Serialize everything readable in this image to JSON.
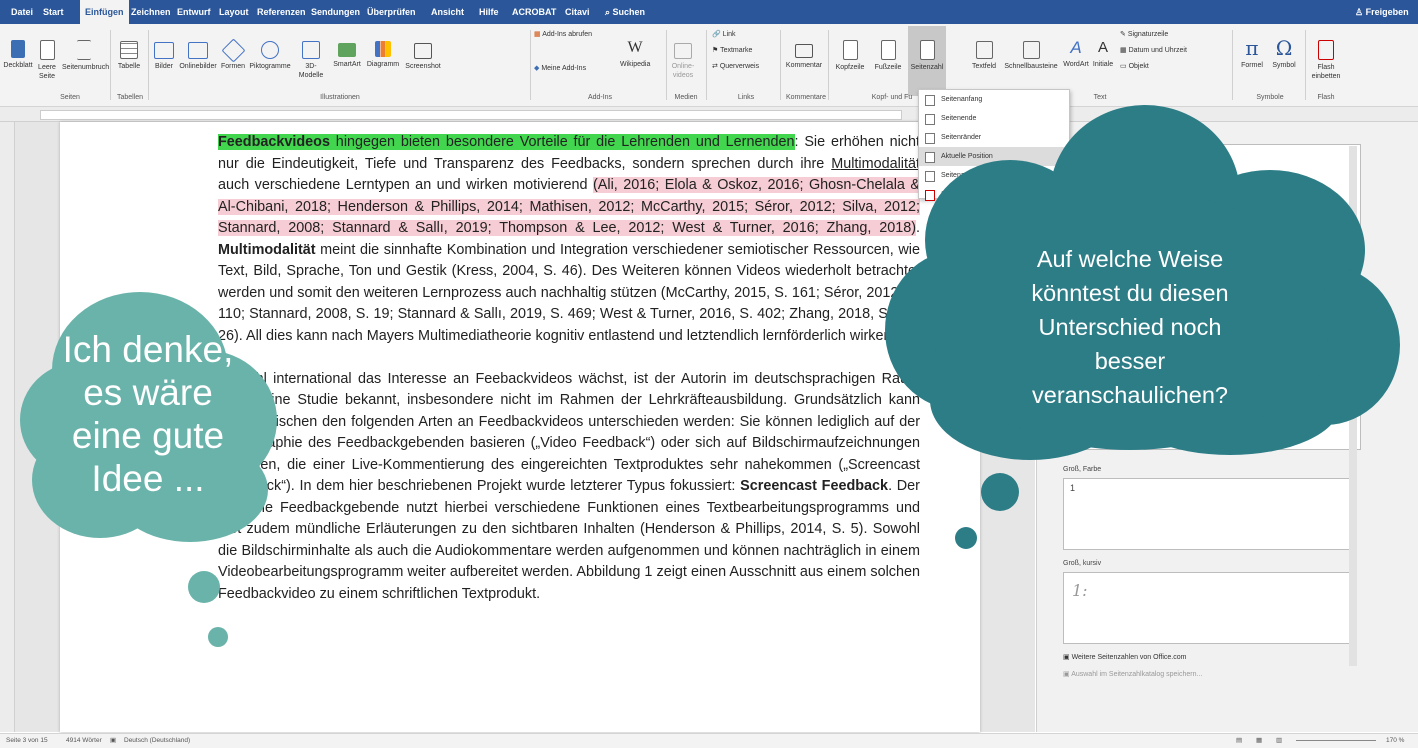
{
  "ribbon_tabs": [
    "Datei",
    "Start",
    "Einfügen",
    "Zeichnen",
    "Entwurf",
    "Layout",
    "Referenzen",
    "Sendungen",
    "Überprüfen",
    "Ansicht",
    "Hilfe",
    "ACROBAT",
    "Citavi"
  ],
  "active_tab": "Einfügen",
  "search_label": "Suchen",
  "share_label": "Freigeben",
  "ribbon_buttons": [
    "Deckblatt",
    "Leere Seite",
    "Seitenumbruch",
    "Tabelle",
    "Bilder",
    "Onlinebilder",
    "Formen",
    "Piktogramme",
    "3D-Modelle",
    "SmartArt",
    "Diagramm",
    "Screenshot",
    "Add-Ins abrufen",
    "Meine Add-Ins",
    "Wikipedia",
    "Online-videos",
    "Link",
    "Textmarke",
    "Querverweis",
    "Kommentar",
    "Kopfzeile",
    "Fußzeile",
    "Seitenzahl",
    "Textfeld",
    "Schnellbausteine",
    "WordArt",
    "Initiale",
    "Signaturzeile",
    "Datum und Uhrzeit",
    "Objekt",
    "Formel",
    "Symbol",
    "Flash einbetten"
  ],
  "ribbon_groups": [
    "Seiten",
    "Tabellen",
    "Illustrationen",
    "Add-Ins",
    "Medien",
    "Links",
    "Kommentare",
    "Kopf- und Fu",
    "Text",
    "Symbole",
    "Flash"
  ],
  "dropdown_items": [
    "Seitenanfang",
    "Seitenende",
    "Seitenränder",
    "Aktuelle Position",
    "Seitenzahlen formatieren...",
    "Seitenzahlen entfernen"
  ],
  "panel": {
    "label1": "Groß, Farbe",
    "value1": "1",
    "label2": "Groß, kursiv",
    "value2": "1:",
    "link1": "Weitere Seitenzahlen von Office.com",
    "link2": "Auswahl im Seitenzahlkatalog speichern..."
  },
  "document": {
    "p1_green": "Feedbackvideos",
    "p1_green_rest": " hingegen bieten besondere Vorteile für die Lehrenden und Lernenden",
    "p1_a": ": Sie erhöhen nicht nur die Eindeutigkeit, Tiefe und Transparenz des Feedbacks, sondern sprechen durch ihre ",
    "p1_multi": "Multimodalität",
    "p1_b": " auch verschiedene Lerntypen an und wirken motivierend ",
    "p1_pink": "(Ali, 2016; Elola & Oskoz, 2016; Ghosn-Chelala & Al-Chibani, 2018; Henderson & Phillips, 2014; Mathisen, 2012; McCarthy, 2015; Séror, 2012; Silva, 2012; Stannard, 2008; Stannard & Sallı, 2019; Thompson & Lee, 2012; West & Turner, 2016; Zhang, 2018)",
    "p1_c": ". ",
    "p1_bold": "Multimodalität",
    "p1_d": " meint die sinnhafte Kombination und Integration verschiedener semiotischer Ressourcen, wie Text, Bild, Sprache, Ton und Gestik (Kress, 2004, S. 46). Des Weiteren können Videos wiederholt betrachtet werden und somit den weiteren Lernprozess auch nachhaltig stützen (McCarthy, 2015, S. 161; Séror, 2012, S. 110; Stannard, 2008, S. 19; Stannard & Sallı, 2019, S. 469; West & Turner, 2016, S. 402; Zhang, 2018, S. 25–26). All dies kann nach Mayers Multimediatheorie kognitiv entlastend und letztendlich lernförderlich wirken.",
    "p2_a": "Obwohl international das Interesse an Feebackvideos wächst, ist der Autorin im deutschsprachigen Raum noch keine Studie bekannt, insbesondere nicht im Rahmen der Lehrkräfteausbildung. Grundsätzlich kann dabei zwischen den folgenden Arten an Feedbackvideos unterschieden werden: Sie können lediglich auf der Videographie des Feedbackgebenden basieren („Video Feedback“) oder sich auf Bildschirmaufzeichnungen beziehen, die einer Live-Kommentierung des eingereichten Textproduktes sehr nahekommen („Screencast Feedback“). In dem hier beschriebenen Projekt wurde letzterer Typus fokussiert: ",
    "p2_bold": "Screencast Feedback",
    "p2_b": ". Der oder die Feedbackgebende nutzt hierbei verschiedene Funktionen eines Textbearbeitungsprogramms und gibt zudem mündliche Erläuterungen zu den sichtbaren Inhalten (Henderson & Phillips, 2014, S. 5). Sowohl die Bildschirminhalte als auch die Audiokommentare werden aufgenommen und können nachträglich in einem Videobearbeitungsprogramm weiter aufbereitet werden. Abbildung 1 zeigt einen Ausschnitt aus einem solchen Feedbackvideo zu einem schriftlichen Textprodukt."
  },
  "cloud_left": [
    "Ich denke,",
    "es wäre",
    "eine gute",
    "Idee ..."
  ],
  "cloud_right": [
    "Auf welche Weise",
    "könntest du diesen",
    "Unterschied noch",
    "besser",
    "veranschaulichen?"
  ],
  "status": {
    "page": "Seite 3 von 15",
    "words": "4914 Wörter",
    "language": "Deutsch (Deutschland)",
    "zoom": "170 %"
  },
  "colors": {
    "ribbon": "#2b579a",
    "cloud": "#2d7d87",
    "cloud_small": "#6ab3aa",
    "highlight_green": "#42d64f",
    "highlight_pink": "#f7cdd5"
  }
}
